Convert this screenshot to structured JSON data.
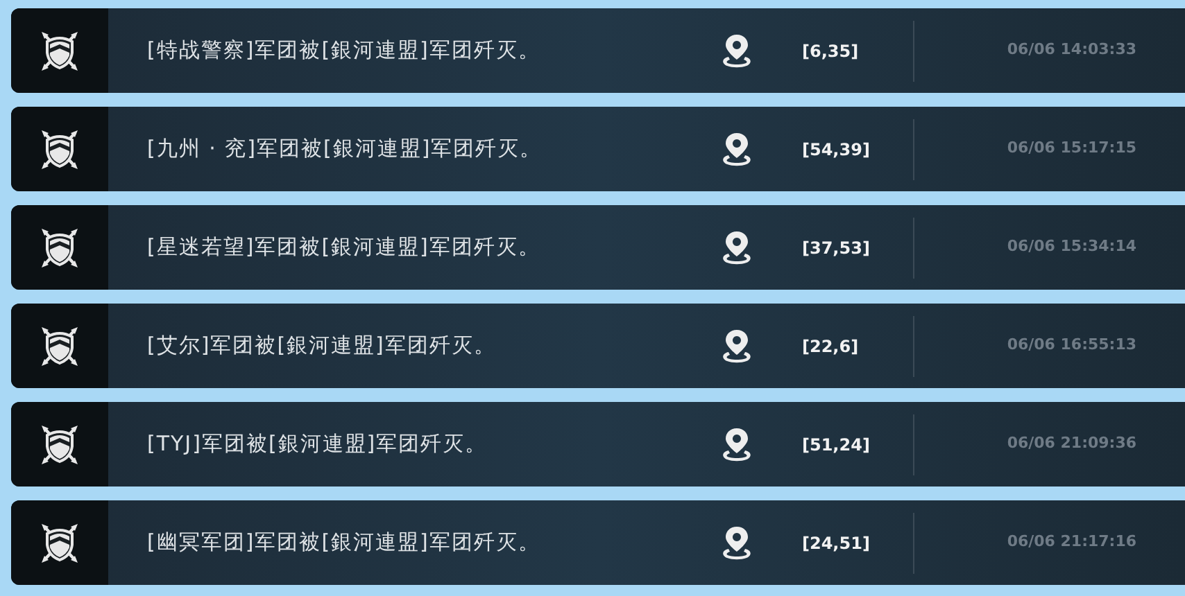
{
  "events": [
    {
      "message": "[特战警察]军团被[銀河連盟]军团歼灭。",
      "coords": "[6,35]",
      "time": "06/06 14:03:33"
    },
    {
      "message": "[九州 · 兖]军团被[銀河連盟]军团歼灭。",
      "coords": "[54,39]",
      "time": "06/06 15:17:15"
    },
    {
      "message": "[星迷若望]军团被[銀河連盟]军团歼灭。",
      "coords": "[37,53]",
      "time": "06/06 15:34:14"
    },
    {
      "message": "[艾尔]军团被[銀河連盟]军团歼灭。",
      "coords": "[22,6]",
      "time": "06/06 16:55:13"
    },
    {
      "message": "[TYJ]军团被[銀河連盟]军团歼灭。",
      "coords": "[51,24]",
      "time": "06/06 21:09:36"
    },
    {
      "message": "[幽冥军团]军团被[銀河連盟]军团歼灭。",
      "coords": "[24,51]",
      "time": "06/06 21:17:16"
    }
  ]
}
